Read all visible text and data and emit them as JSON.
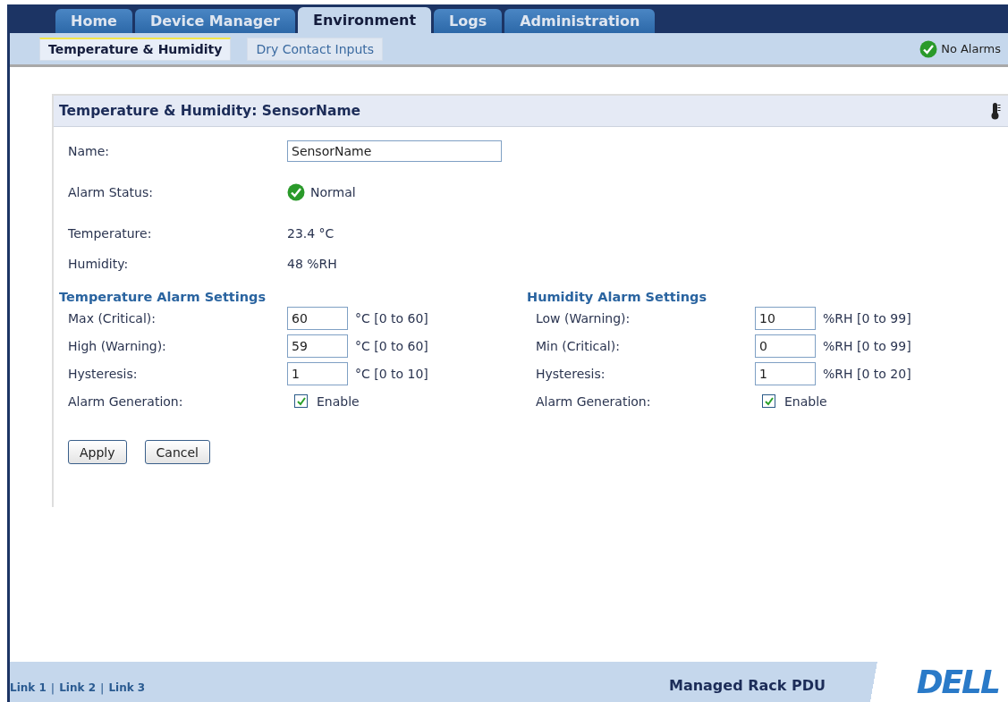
{
  "tabs": [
    {
      "label": "Home",
      "selected": false
    },
    {
      "label": "Device Manager",
      "selected": false
    },
    {
      "label": "Environment",
      "selected": true
    },
    {
      "label": "Logs",
      "selected": false
    },
    {
      "label": "Administration",
      "selected": false
    }
  ],
  "subtabs": [
    {
      "label": "Temperature & Humidity",
      "selected": true
    },
    {
      "label": "Dry Contact Inputs",
      "selected": false
    }
  ],
  "alarm_summary": {
    "label": "No Alarms",
    "ok": true
  },
  "panel": {
    "title": "Temperature & Humidity: SensorName",
    "name": {
      "label": "Name:",
      "value": "SensorName"
    },
    "alarm_status": {
      "label": "Alarm Status:",
      "value": "Normal",
      "ok": true
    },
    "temperature": {
      "label": "Temperature:",
      "value": "23.4 °C"
    },
    "humidity": {
      "label": "Humidity:",
      "value": "48 %RH"
    },
    "settings": [
      {
        "title": "Temperature Alarm Settings",
        "rows": [
          {
            "label": "Max (Critical):",
            "value": "60",
            "unit": "°C [0 to 60]"
          },
          {
            "label": "High (Warning):",
            "value": "59",
            "unit": "°C [0 to 60]"
          },
          {
            "label": "Hysteresis:",
            "value": "1",
            "unit": "°C [0 to 10]"
          }
        ],
        "alarm_generation": {
          "label": "Alarm Generation:",
          "option": "Enable",
          "checked": true
        }
      },
      {
        "title": "Humidity Alarm Settings",
        "rows": [
          {
            "label": "Low (Warning):",
            "value": "10",
            "unit": "%RH [0 to 99]"
          },
          {
            "label": "Min (Critical):",
            "value": "0",
            "unit": "%RH [0 to 99]"
          },
          {
            "label": "Hysteresis:",
            "value": "1",
            "unit": "%RH [0 to 20]"
          }
        ],
        "alarm_generation": {
          "label": "Alarm Generation:",
          "option": "Enable",
          "checked": true
        }
      }
    ],
    "buttons": [
      "Apply",
      "Cancel"
    ]
  },
  "footer": {
    "links": [
      "Link 1",
      "Link 2",
      "Link 3"
    ],
    "separator": "|",
    "product": "Managed Rack PDU",
    "logo": "DELL"
  }
}
